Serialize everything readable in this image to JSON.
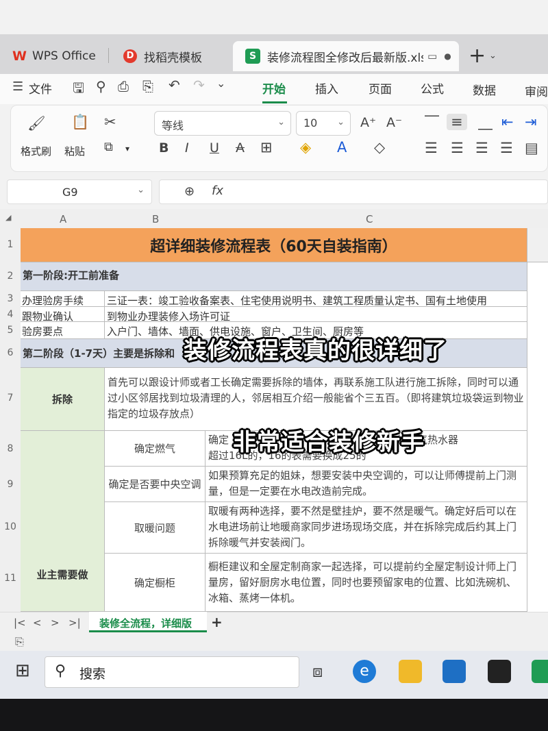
{
  "tabs": [
    {
      "label": "WPS Office",
      "icon": "wps-logo"
    },
    {
      "label": "找稻壳模板",
      "icon": "daoke-logo"
    },
    {
      "label": "装修流程图全修改后最新版.xls",
      "icon": "spreadsheet-logo"
    }
  ],
  "new_tab": "+",
  "menu": {
    "file": "文件",
    "items": [
      "开始",
      "插入",
      "页面",
      "公式",
      "数据",
      "审阅"
    ]
  },
  "ribbon": {
    "format_painter": "格式刷",
    "paste": "粘贴",
    "font_name": "等线",
    "font_size": "10",
    "bold": "B",
    "italic": "I",
    "underline": "U",
    "strike": "A"
  },
  "formula": {
    "cell_ref": "G9",
    "fx": "fx"
  },
  "columns": [
    "A",
    "B",
    "C"
  ],
  "rows": [
    "1",
    "2",
    "3",
    "4",
    "5",
    "6",
    "7",
    "8",
    "9",
    "10",
    "11"
  ],
  "sheet": {
    "title": "超详细装修流程表（60天自装指南）",
    "phase1": "第一阶段:开工前准备",
    "r3_label": "办理验房手续",
    "r3_value": "三证一表：竣工验收备案表、住宅使用说明书、建筑工程质量认定书、国有土地使用",
    "r4_label": "跟物业确认",
    "r4_value": "到物业办理装修入场许可证",
    "r5_label": "验房要点",
    "r5_value": "入户门、墙体、墙面、供电设施、窗户、卫生间、厨房等",
    "phase2": "第二阶段（1-7天）主要是拆除和",
    "demolish_label": "拆除",
    "demolish_text": "首先可以跟设计师或者工长确定需要拆除的墙体，再联系施工队进行施工拆除，同时可以通过小区邻居找到垃圾清理的人，邻居相互介绍一般能省个三五百。（即将建筑垃圾袋运到物业指定的垃圾存放点）",
    "owner_label": "业主需要做",
    "r8_label": "确定燃气",
    "r8_value_a": "确定",
    "r8_value_b": "如果选的燃气热水器",
    "r8_value_c": "超过16L的，16的表需要换成25的",
    "r9_label": "确定是否要中央空调",
    "r9_value": "如果预算充足的姐妹，想要安装中央空调的，可以让师傅提前上门测量，但是一定要在水电改造前完成。",
    "r10_label": "取暖问题",
    "r10_value": "取暖有两种选择，要不然是壁挂炉，要不然是暖气。确定好后可以在水电进场前让地暖商家同步进场现场交底，并在拆除完成后约其上门拆除暖气并安装阀门。",
    "r11_label": "确定橱柜",
    "r11_value": "橱柜建议和全屋定制商家一起选择，可以提前约全屋定制设计师上门量房，留好厨房水电位置，同时也要预留家电的位置、比如洗碗机、冰箱、蒸烤一体机。"
  },
  "overlays": {
    "caption1": "装修流程表真的很详细了",
    "caption2": "非常适合装修新手"
  },
  "sheet_tab": "装修全流程，详细版",
  "add_sheet": "+",
  "taskbar": {
    "search": "搜索"
  },
  "colors": {
    "accent": "#1a8c4a",
    "title_bg": "#f4a25b",
    "phase_bg": "#d7dde9",
    "green_bg": "#e3efd8"
  }
}
